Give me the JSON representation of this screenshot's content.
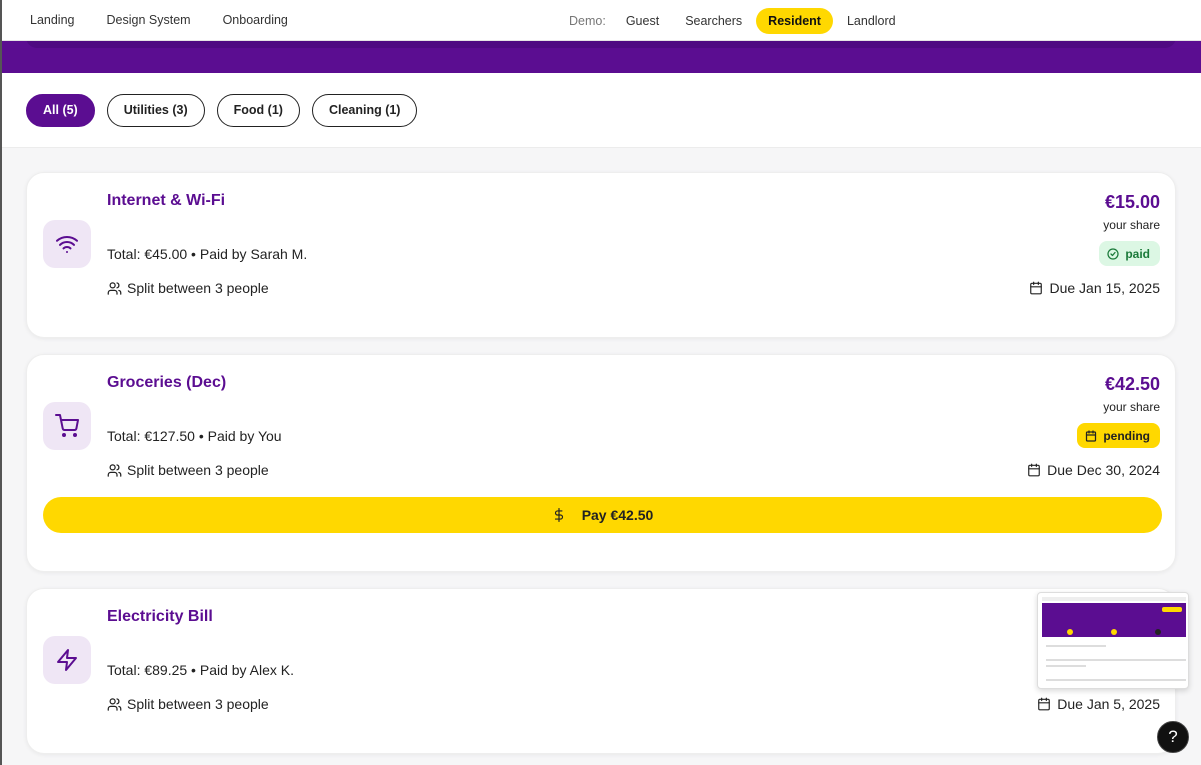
{
  "nav": {
    "links": [
      "Landing",
      "Design System",
      "Onboarding"
    ],
    "demo_label": "Demo:",
    "demo_roles": [
      "Guest",
      "Searchers",
      "Resident",
      "Landlord"
    ],
    "active_role": "Resident"
  },
  "filters": [
    {
      "label": "All (5)",
      "active": true
    },
    {
      "label": "Utilities (3)",
      "active": false
    },
    {
      "label": "Food (1)",
      "active": false
    },
    {
      "label": "Cleaning (1)",
      "active": false
    }
  ],
  "expenses": [
    {
      "icon": "wifi-icon",
      "title": "Internet & Wi-Fi",
      "meta": "Total: €45.00 • Paid by Sarah M.",
      "split": "Split between 3 people",
      "amount": "€15.00",
      "share": "your share",
      "status": "paid",
      "due": "Due Jan 15, 2025"
    },
    {
      "icon": "cart-icon",
      "title": "Groceries (Dec)",
      "meta": "Total: €127.50 • Paid by You",
      "split": "Split between 3 people",
      "amount": "€42.50",
      "share": "your share",
      "status": "pending",
      "due": "Due Dec 30, 2024",
      "pay_label": "Pay €42.50"
    },
    {
      "icon": "lightning-icon",
      "title": "Electricity Bill",
      "meta": "Total: €89.25 • Paid by Alex K.",
      "split": "Split between 3 people",
      "due": "Due Jan 5, 2025"
    }
  ],
  "help": {
    "label": "?"
  },
  "colors": {
    "brand_purple": "#5b0d91",
    "accent_yellow": "#ffd800",
    "paid_bg": "#dcf7e4",
    "paid_text": "#1b7a3a"
  }
}
